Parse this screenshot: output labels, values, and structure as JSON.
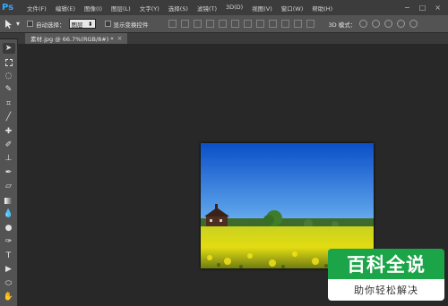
{
  "app": {
    "logo": "Ps"
  },
  "menu": [
    "文件(F)",
    "编辑(E)",
    "图像(I)",
    "图层(L)",
    "文字(Y)",
    "选择(S)",
    "滤镜(T)",
    "3D(D)",
    "视图(V)",
    "窗口(W)",
    "帮助(H)"
  ],
  "window_controls": [
    "−",
    "□",
    "×"
  ],
  "options": {
    "tool_icon": "move-tool-icon",
    "auto_select_label": "自动选择：",
    "auto_select_value": "图层",
    "show_transform_label": "显示变换控件",
    "mode_3d_label": "3D 模式："
  },
  "document": {
    "tab_title": "素材.jpg @ 66.7%(RGB/8#) *",
    "close": "×"
  },
  "tools": [
    "move-tool",
    "marquee-tool",
    "lasso-tool",
    "quick-select-tool",
    "crop-tool",
    "eyedropper-tool",
    "healing-brush-tool",
    "brush-tool",
    "clone-stamp-tool",
    "history-brush-tool",
    "eraser-tool",
    "gradient-tool",
    "blur-tool",
    "dodge-tool",
    "pen-tool",
    "type-tool",
    "path-select-tool",
    "shape-tool",
    "hand-tool"
  ],
  "watermark": {
    "title": "百科全说",
    "subtitle": "助你轻松解决"
  },
  "colors": {
    "menubar": "#3c3c3c",
    "optionsbar": "#535353",
    "canvas": "#282828",
    "brand": "#1ba548"
  }
}
